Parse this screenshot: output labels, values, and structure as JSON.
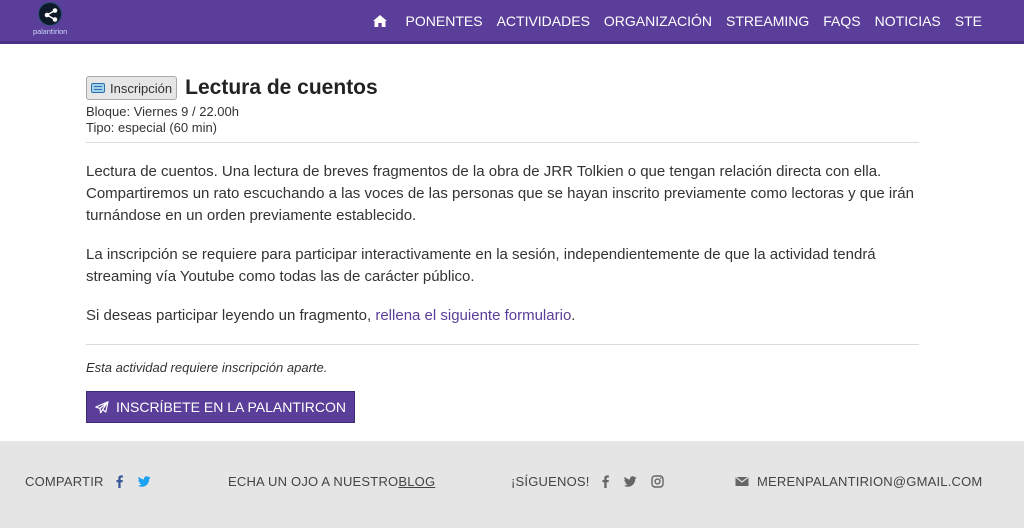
{
  "nav": {
    "logo_text": "palantirion",
    "home_icon": "home-icon",
    "links": [
      "PONENTES",
      "ACTIVIDADES",
      "ORGANIZACIÓN",
      "STREAMING",
      "FAQS",
      "NOTICIAS",
      "STE"
    ]
  },
  "activity": {
    "badge": "Inscripción",
    "badge_icon": "ticket-icon",
    "title": "Lectura de cuentos",
    "block": "Bloque: Viernes 9 / 22.00h",
    "type": "Tipo: especial (60 min)",
    "description": "Lectura de cuentos. Una lectura de breves fragmentos de la obra de JRR Tolkien o que tengan relación directa con ella. Compartiremos un rato escuchando a las voces de las personas que se hayan inscrito previamente como lectoras y que irán turnándose en un orden previamente establecido.",
    "registration_info": "La inscripción se requiere para participar interactivamente en la sesión, independientemente de que la actividad tendrá streaming vía Youtube como todas las de carácter público.",
    "form_prefix": "Si deseas participar leyendo un fragmento, ",
    "form_link": "rellena el siguiente formulario",
    "form_suffix": ".",
    "note": "Esta actividad requiere inscripción aparte.",
    "cta_label": "INSCRÍBETE EN LA PALANTIRCON",
    "cta_icon": "paper-plane-icon"
  },
  "footer": {
    "share_label": "COMPARTIR",
    "blog_prefix": "ECHA UN OJO A NUESTRO ",
    "blog_link": "BLOG",
    "follow_label": "¡SÍGUENOS!",
    "email": "MERENPALANTIRION@GMAIL.COM"
  },
  "colors": {
    "brand": "#5a3e99",
    "twitter": "#1da1f2",
    "footer_bg": "#e5e5e5"
  }
}
